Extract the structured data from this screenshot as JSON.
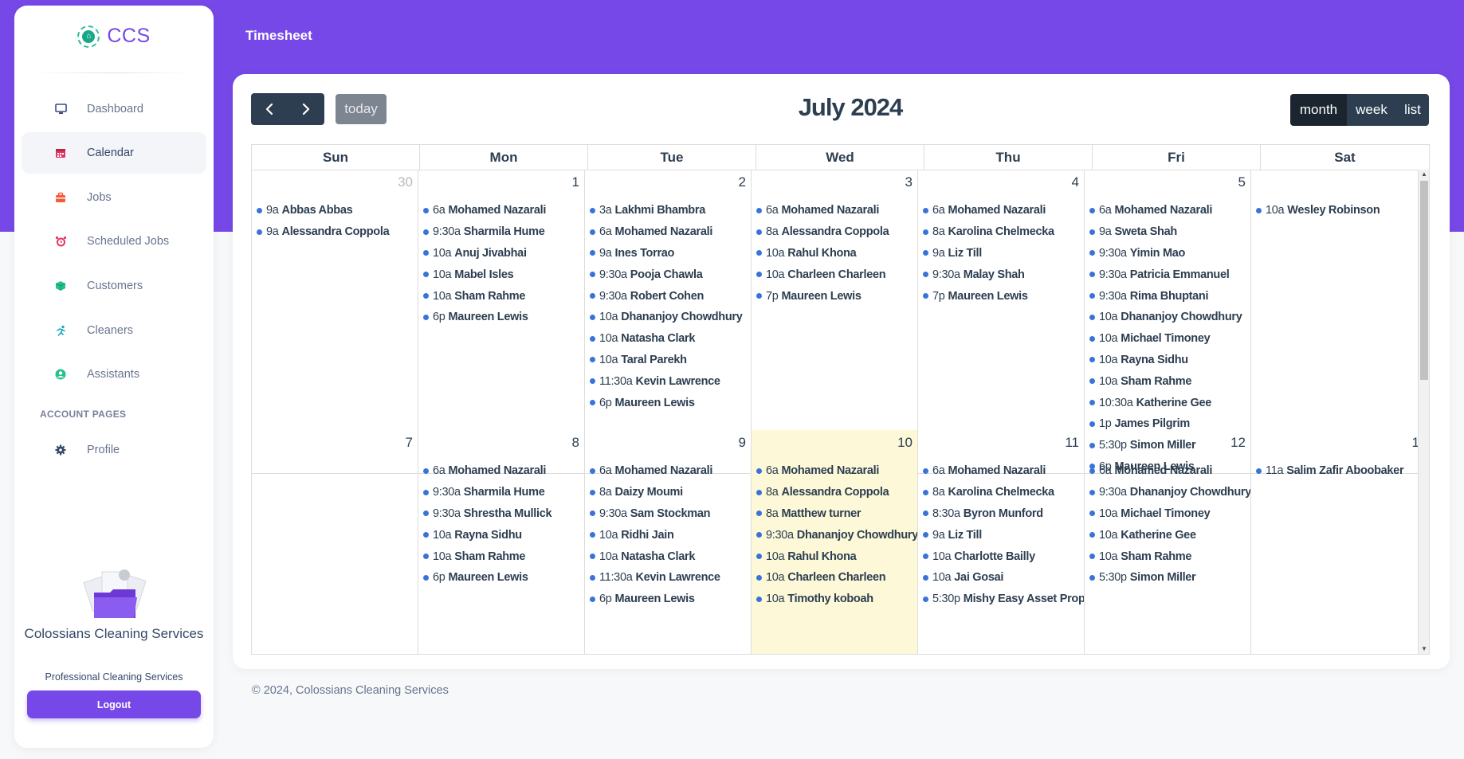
{
  "sidebar": {
    "brand": "CCS",
    "items": [
      {
        "label": "Dashboard",
        "icon": "monitor-icon",
        "color": "#3d4a8a"
      },
      {
        "label": "Calendar",
        "icon": "calendar-icon",
        "color": "#e53562"
      },
      {
        "label": "Jobs",
        "icon": "briefcase-icon",
        "color": "#f55a3a"
      },
      {
        "label": "Scheduled Jobs",
        "icon": "alarm-clock-icon",
        "color": "#e53562"
      },
      {
        "label": "Customers",
        "icon": "box-icon",
        "color": "#22c38e"
      },
      {
        "label": "Cleaners",
        "icon": "running-person-icon",
        "color": "#1ba7c8"
      },
      {
        "label": "Assistants",
        "icon": "user-circle-icon",
        "color": "#22c38e"
      }
    ],
    "account_section_title": "ACCOUNT PAGES",
    "account_items": [
      {
        "label": "Profile",
        "icon": "gear-icon",
        "color": "#344767"
      }
    ],
    "company_name": "Colossians Cleaning Services",
    "company_tagline": "Professional Cleaning Services",
    "logout_label": "Logout"
  },
  "header": {
    "title": "Timesheet"
  },
  "calendar": {
    "title": "July 2024",
    "today_label": "today",
    "views": [
      {
        "label": "month",
        "active": true
      },
      {
        "label": "week",
        "active": false
      },
      {
        "label": "list",
        "active": false
      }
    ],
    "weekdays": [
      "Sun",
      "Mon",
      "Tue",
      "Wed",
      "Thu",
      "Fri",
      "Sat"
    ],
    "weeks": [
      [
        {
          "num": "30",
          "other": true,
          "events": [
            {
              "time": "9a",
              "title": "Abbas Abbas"
            },
            {
              "time": "9a",
              "title": "Alessandra Coppola"
            }
          ]
        },
        {
          "num": "1",
          "events": [
            {
              "time": "6a",
              "title": "Mohamed Nazarali"
            },
            {
              "time": "9:30a",
              "title": "Sharmila Hume"
            },
            {
              "time": "10a",
              "title": "Anuj Jivabhai"
            },
            {
              "time": "10a",
              "title": "Mabel Isles"
            },
            {
              "time": "10a",
              "title": "Sham Rahme"
            },
            {
              "time": "6p",
              "title": "Maureen Lewis"
            }
          ]
        },
        {
          "num": "2",
          "events": [
            {
              "time": "3a",
              "title": "Lakhmi Bhambra"
            },
            {
              "time": "6a",
              "title": "Mohamed Nazarali"
            },
            {
              "time": "9a",
              "title": "Ines Torrao"
            },
            {
              "time": "9:30a",
              "title": "Pooja Chawla"
            },
            {
              "time": "9:30a",
              "title": "Robert Cohen"
            },
            {
              "time": "10a",
              "title": "Dhananjoy Chowdhury"
            },
            {
              "time": "10a",
              "title": "Natasha Clark"
            },
            {
              "time": "10a",
              "title": "Taral Parekh"
            },
            {
              "time": "11:30a",
              "title": "Kevin Lawrence"
            },
            {
              "time": "6p",
              "title": "Maureen Lewis"
            }
          ]
        },
        {
          "num": "3",
          "events": [
            {
              "time": "6a",
              "title": "Mohamed Nazarali"
            },
            {
              "time": "8a",
              "title": "Alessandra Coppola"
            },
            {
              "time": "10a",
              "title": "Rahul Khona"
            },
            {
              "time": "10a",
              "title": "Charleen Charleen"
            },
            {
              "time": "7p",
              "title": "Maureen Lewis"
            }
          ]
        },
        {
          "num": "4",
          "events": [
            {
              "time": "6a",
              "title": "Mohamed Nazarali"
            },
            {
              "time": "8a",
              "title": "Karolina Chelmecka"
            },
            {
              "time": "9a",
              "title": "Liz Till"
            },
            {
              "time": "9:30a",
              "title": "Malay Shah"
            },
            {
              "time": "7p",
              "title": "Maureen Lewis"
            }
          ]
        },
        {
          "num": "5",
          "events": [
            {
              "time": "6a",
              "title": "Mohamed Nazarali"
            },
            {
              "time": "9a",
              "title": "Sweta Shah"
            },
            {
              "time": "9:30a",
              "title": "Yimin Mao"
            },
            {
              "time": "9:30a",
              "title": "Patricia Emmanuel"
            },
            {
              "time": "9:30a",
              "title": "Rima Bhuptani"
            },
            {
              "time": "10a",
              "title": "Dhananjoy Chowdhury"
            },
            {
              "time": "10a",
              "title": "Michael Timoney"
            },
            {
              "time": "10a",
              "title": "Rayna Sidhu"
            },
            {
              "time": "10a",
              "title": "Sham Rahme"
            },
            {
              "time": "10:30a",
              "title": "Katherine Gee"
            },
            {
              "time": "1p",
              "title": "James Pilgrim"
            },
            {
              "time": "5:30p",
              "title": "Simon Miller"
            },
            {
              "time": "6p",
              "title": "Maureen Lewis"
            }
          ]
        },
        {
          "num": "",
          "events": [
            {
              "time": "10a",
              "title": "Wesley Robinson"
            }
          ]
        }
      ],
      [
        {
          "num": "7",
          "events": []
        },
        {
          "num": "8",
          "events": [
            {
              "time": "6a",
              "title": "Mohamed Nazarali"
            },
            {
              "time": "9:30a",
              "title": "Sharmila Hume"
            },
            {
              "time": "9:30a",
              "title": "Shrestha Mullick"
            },
            {
              "time": "10a",
              "title": "Rayna Sidhu"
            },
            {
              "time": "10a",
              "title": "Sham Rahme"
            },
            {
              "time": "6p",
              "title": "Maureen Lewis"
            }
          ]
        },
        {
          "num": "9",
          "events": [
            {
              "time": "6a",
              "title": "Mohamed Nazarali"
            },
            {
              "time": "8a",
              "title": "Daizy Moumi"
            },
            {
              "time": "9:30a",
              "title": "Sam Stockman"
            },
            {
              "time": "10a",
              "title": "Ridhi Jain"
            },
            {
              "time": "10a",
              "title": "Natasha Clark"
            },
            {
              "time": "11:30a",
              "title": "Kevin Lawrence"
            },
            {
              "time": "6p",
              "title": "Maureen Lewis"
            }
          ]
        },
        {
          "num": "10",
          "today": true,
          "events": [
            {
              "time": "6a",
              "title": "Mohamed Nazarali"
            },
            {
              "time": "8a",
              "title": "Alessandra Coppola"
            },
            {
              "time": "8a",
              "title": "Matthew turner"
            },
            {
              "time": "9:30a",
              "title": "Dhananjoy Chowdhury"
            },
            {
              "time": "10a",
              "title": "Rahul Khona"
            },
            {
              "time": "10a",
              "title": "Charleen Charleen"
            },
            {
              "time": "10a",
              "title": "Timothy koboah"
            }
          ]
        },
        {
          "num": "11",
          "events": [
            {
              "time": "6a",
              "title": "Mohamed Nazarali"
            },
            {
              "time": "8a",
              "title": "Karolina Chelmecka"
            },
            {
              "time": "8:30a",
              "title": "Byron Munford"
            },
            {
              "time": "9a",
              "title": "Liz Till"
            },
            {
              "time": "10a",
              "title": "Charlotte Bailly"
            },
            {
              "time": "10a",
              "title": "Jai Gosai"
            },
            {
              "time": "5:30p",
              "title": "Mishy Easy Asset Proper"
            }
          ]
        },
        {
          "num": "12",
          "events": [
            {
              "time": "6a",
              "title": "Mohamed Nazarali"
            },
            {
              "time": "9:30a",
              "title": "Dhananjoy Chowdhury"
            },
            {
              "time": "10a",
              "title": "Michael Timoney"
            },
            {
              "time": "10a",
              "title": "Katherine Gee"
            },
            {
              "time": "10a",
              "title": "Sham Rahme"
            },
            {
              "time": "5:30p",
              "title": "Simon Miller"
            }
          ]
        },
        {
          "num": "1",
          "events": [
            {
              "time": "11a",
              "title": "Salim Zafir Aboobaker"
            }
          ]
        }
      ]
    ]
  },
  "footer": {
    "text": "© 2024, Colossians Cleaning Services"
  },
  "colors": {
    "accent": "#7648e8",
    "fc_button": "#2c3e50",
    "today_bg": "#fcf8d8",
    "event_dot": "#3a73d8"
  }
}
